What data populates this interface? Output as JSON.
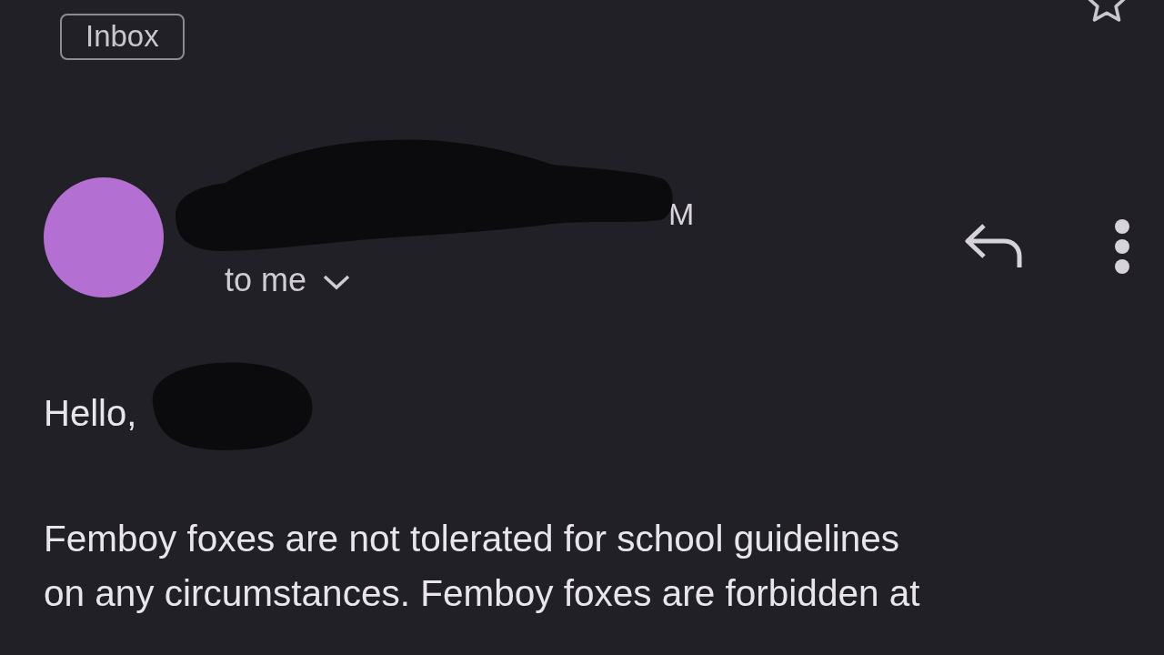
{
  "label": "Inbox",
  "starred": false,
  "sender": {
    "name_tail": "M",
    "recipient": "to me"
  },
  "greeting": "Hello,",
  "body_lines": [
    "Femboy foxes are not tolerated for school guidelines",
    "on any circumstances. Femboy foxes are forbidden at"
  ]
}
